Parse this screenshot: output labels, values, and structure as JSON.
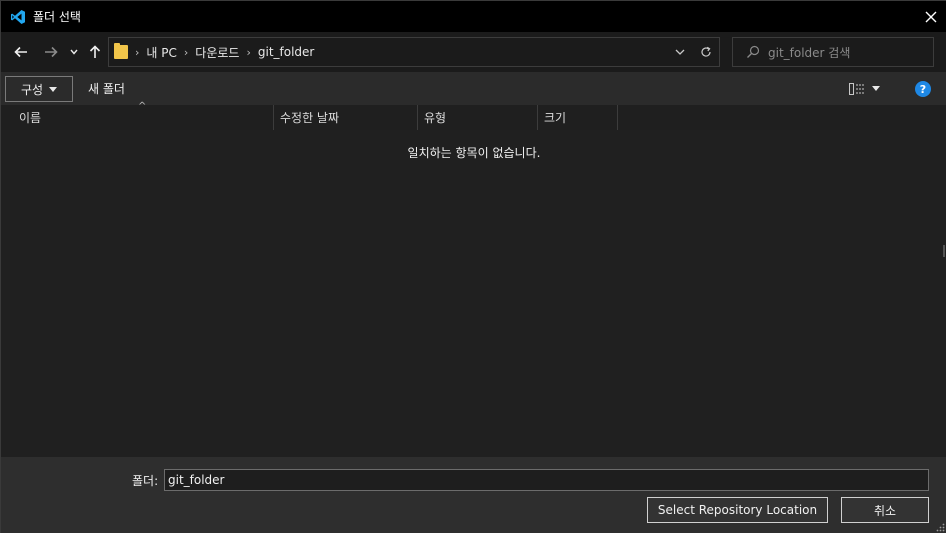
{
  "window": {
    "title": "폴더 선택",
    "app_icon": "vscode-icon",
    "close_icon": "close-icon"
  },
  "nav": {
    "back_icon": "arrow-left-icon",
    "forward_icon": "arrow-right-icon",
    "recent_icon": "chevron-down-icon",
    "up_icon": "arrow-up-icon",
    "breadcrumb": [
      "내 PC",
      "다운로드",
      "git_folder"
    ],
    "refresh_icon": "refresh-icon",
    "search_placeholder": "git_folder 검색"
  },
  "toolbar": {
    "organize_label": "구성",
    "new_folder_label": "새 폴더",
    "help_label": "?"
  },
  "columns": [
    "이름",
    "수정한 날짜",
    "유형",
    "크기"
  ],
  "empty_message": "일치하는 항목이 없습니다.",
  "bottom": {
    "folder_label": "폴더:",
    "folder_value": "git_folder",
    "select_button": "Select Repository Location",
    "cancel_button": "취소"
  },
  "colors": {
    "accent": "#1e88e5",
    "folder": "#f1c54a",
    "vscode_blue": "#22a7f0"
  }
}
